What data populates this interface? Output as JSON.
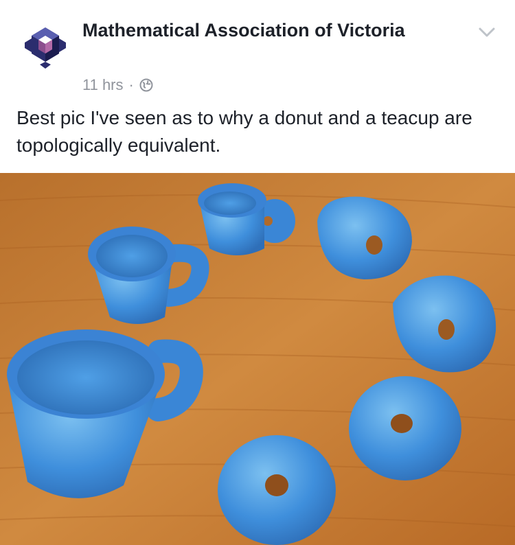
{
  "post": {
    "author": "Mathematical Association of Victoria",
    "timestamp": "11 hrs",
    "separator": "·",
    "privacy_icon": "globe-icon",
    "options_icon": "chevron-down-icon",
    "avatar_logo_text": "The Mathematical Association of Victoria",
    "text": "Best pic I've seen as to why a donut and a teacup are topologically equivalent."
  },
  "photo": {
    "subject": "seven blue ceramic objects morphing from a mug into a donut on a wooden table",
    "colors": {
      "object_blue": "#3d8ee0",
      "wood": "#c8803a"
    }
  },
  "colors": {
    "text": "#1d2129",
    "meta": "#90949c",
    "background": "#ffffff"
  }
}
